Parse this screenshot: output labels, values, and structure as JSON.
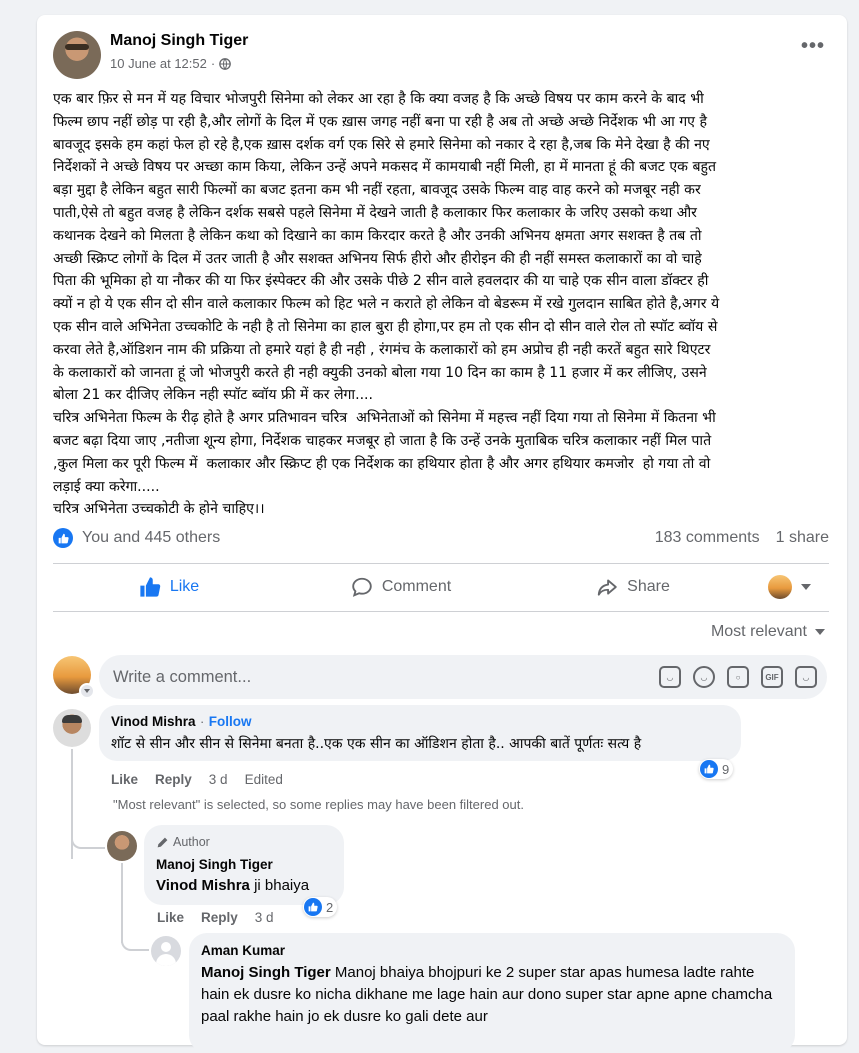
{
  "post": {
    "author": "Manoj Singh Tiger",
    "date": "10 June at 12:52",
    "separator": "·",
    "body": "एक बार फ़िर से मन में यह विचार भोजपुरी सिनेमा को लेकर आ रहा है कि क्या वजह है कि अच्छे विषय पर काम करने के बाद भी\nफिल्म छाप नहीं छोड़ पा रही है,और लोगों के दिल में एक ख़ास जगह नहीं बना पा रही है अब तो अच्छे अच्छे निर्देशक भी आ गए है\nबावजूद इसके हम कहां फेल हो रहे है,एक ख़ास दर्शक वर्ग एक सिरे से हमारे सिनेमा को नकार दे रहा है,जब कि मेने देखा है की नए\nनिर्देशकों ने अच्छे विषय पर अच्छा काम किया, लेकिन उन्हें अपने मकसद में कामयाबी नहीं मिली, हा में मानता हूं की बजट एक बहुत\nबड़ा मुद्दा है लेकिन बहुत सारी फिल्मों का बजट इतना कम भी नहीं रहता, बावजूद उसके फिल्म वाह वाह करने को मजबूर नही कर\nपाती,ऐसे तो बहुत वजह है लेकिन दर्शक सबसे पहले सिनेमा में देखने जाती है कलाकार फिर कलाकार के जरिए उसको कथा और\nकथानक देखने को मिलता है लेकिन कथा को दिखाने का काम किरदार करते है और उनकी अभिनय क्षमता अगर सशक्त है तब तो\nअच्छी स्क्रिप्ट लोगों के दिल में उतर जाती है और सशक्त अभिनय सिर्फ हीरो और हीरोइन की ही नहीं समस्त कलाकारों का वो चाहे\nपिता की भूमिका हो या नौकर की या फिर इंस्पेक्टर की और उसके पीछे 2 सीन वाले हवलदार की या चाहे एक सीन वाला डॉक्टर ही\nक्यों न हो ये एक सीन दो सीन वाले कलाकार फिल्म को हिट भले न कराते हो लेकिन वो बेडरूम में रखे गुलदान साबित होते है,अगर ये\nएक सीन वाले अभिनेता उच्चकोटि के नही है तो सिनेमा का हाल बुरा ही होगा,पर हम तो एक सीन दो सीन वाले रोल तो स्पॉट ब्वॉय से\nकरवा लेते है,ऑडिशन नाम की प्रक्रिया तो हमारे यहां है ही नही , रंगमंच के कलाकारों को हम अप्रोच ही नही करतें बहुत सारे थिएटर\nके कलाकारों को जानता हूं जो भोजपुरी करते ही नही क्युकी उनको बोला गया 10 दिन का काम है 11 हजार में कर लीजिए, उसने\nबोला 21 कर दीजिए लेकिन नही स्पॉट ब्वॉय फ्री में कर लेगा....\nचरित्र अभिनेता फिल्म के रीढ़ होते है अगर प्रतिभावन चरित्र  अभिनेताओं को सिनेमा में महत्त्व नहीं दिया गया तो सिनेमा में कितना भी\nबजट बढ़ा दिया जाए ,नतीजा शून्य होगा, निर्देशक चाहकर मजबूर हो जाता है कि उन्हें उनके मुताबिक चरित्र कलाकार नहीं मिल पाते\n,कुल मिला कर पूरी फिल्म में  कलाकार और स्क्रिप्ट ही एक निर्देशक का हथियार होता है और अगर हथियार कमजोर  हो गया तो वो\nलड़ाई क्या करेगा.....\nचरित्र अभिनेता उच्चकोटी के होने चाहिए।।"
  },
  "reactions": {
    "summary": "You and 445 others",
    "comments": "183 comments",
    "shares": "1 share"
  },
  "actions": {
    "like": "Like",
    "comment": "Comment",
    "share": "Share"
  },
  "sort": {
    "label": "Most relevant"
  },
  "composer": {
    "placeholder": "Write a comment...",
    "gif_label": "GIF"
  },
  "comments": [
    {
      "author": "Vinod Mishra",
      "separator": "·",
      "follow": "Follow",
      "text": "शॉट से सीन और सीन से सिनेमा बनता है..एक एक सीन का ऑडिशन होता है.. आपकी बातें पूर्णतः सत्य है",
      "like": "Like",
      "reply": "Reply",
      "time": "3 d",
      "edited": "Edited",
      "reaction_count": "9"
    }
  ],
  "filter_note": "\"Most relevant\" is selected, so some replies may have been filtered out.",
  "replies": [
    {
      "badge": "Author",
      "author": "Manoj Singh Tiger",
      "mention": "Vinod Mishra",
      "text": " ji bhaiya",
      "like": "Like",
      "reply": "Reply",
      "time": "3 d",
      "reaction_count": "2"
    },
    {
      "author": "Aman Kumar",
      "mention": "Manoj Singh Tiger",
      "text": " Manoj bhaiya bhojpuri ke 2 super star apas humesa ladte rahte hain ek dusre ko nicha dikhane me lage hain aur dono super star apne apne chamcha paal rakhe hain jo ek dusre ko gali dete aur"
    }
  ],
  "colors": {
    "accent": "#1877f2",
    "muted": "#65676b",
    "bubble": "#f0f2f5"
  }
}
